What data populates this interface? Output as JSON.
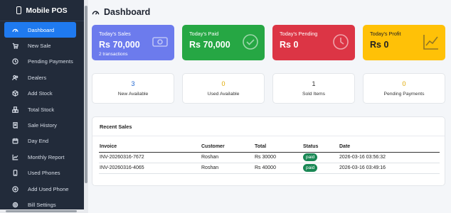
{
  "sidebar": {
    "brand": "Mobile POS",
    "items": [
      {
        "label": "Dashboard",
        "icon": "dashboard-icon"
      },
      {
        "label": "New Sale",
        "icon": "cart-icon"
      },
      {
        "label": "Pending Payments",
        "icon": "clock-icon"
      },
      {
        "label": "Dealers",
        "icon": "users-icon"
      },
      {
        "label": "Add Stock",
        "icon": "box-icon"
      },
      {
        "label": "Total Stock",
        "icon": "boxes-icon"
      },
      {
        "label": "Sale History",
        "icon": "receipt-icon"
      },
      {
        "label": "Day End",
        "icon": "calendar-icon"
      },
      {
        "label": "Monthly Report",
        "icon": "chart-icon"
      },
      {
        "label": "Used Phones",
        "icon": "phone-stack-icon"
      },
      {
        "label": "Add Used Phone",
        "icon": "plus-circle-icon"
      },
      {
        "label": "Bill Settings",
        "icon": "gear-icon"
      }
    ]
  },
  "header": {
    "title": "Dashboard"
  },
  "stats": [
    {
      "label": "Today's Sales",
      "value": "Rs 70,000",
      "sub": "2 transactions",
      "color": "#6c7bed",
      "icon": "cash-icon"
    },
    {
      "label": "Today's Paid",
      "value": "Rs 70,000",
      "color": "#26a744",
      "icon": "check-circle-icon"
    },
    {
      "label": "Today's Pending",
      "value": "Rs 0",
      "color": "#dc3545",
      "icon": "clock-icon"
    },
    {
      "label": "Today's Profit",
      "value": "Rs 0",
      "color": "#ffc107",
      "icon": "trend-icon"
    }
  ],
  "minis": [
    {
      "value": "3",
      "label": "New Available"
    },
    {
      "value": "0",
      "label": "Used Available"
    },
    {
      "value": "1",
      "label": "Sold Items"
    },
    {
      "value": "0",
      "label": "Pending Payments"
    }
  ],
  "recent_sales": {
    "title": "Recent Sales",
    "columns": [
      "Invoice",
      "Customer",
      "Total",
      "Status",
      "Date"
    ],
    "rows": [
      {
        "invoice": "INV-20260316-7672",
        "customer": "Roshan",
        "total": "Rs 30000",
        "status": "paid",
        "date": "2026-03-16 03:56:32"
      },
      {
        "invoice": "INV-20260316-4065",
        "customer": "Roshan",
        "total": "Rs 40000",
        "status": "paid",
        "date": "2026-03-16 03:49:16"
      }
    ]
  }
}
